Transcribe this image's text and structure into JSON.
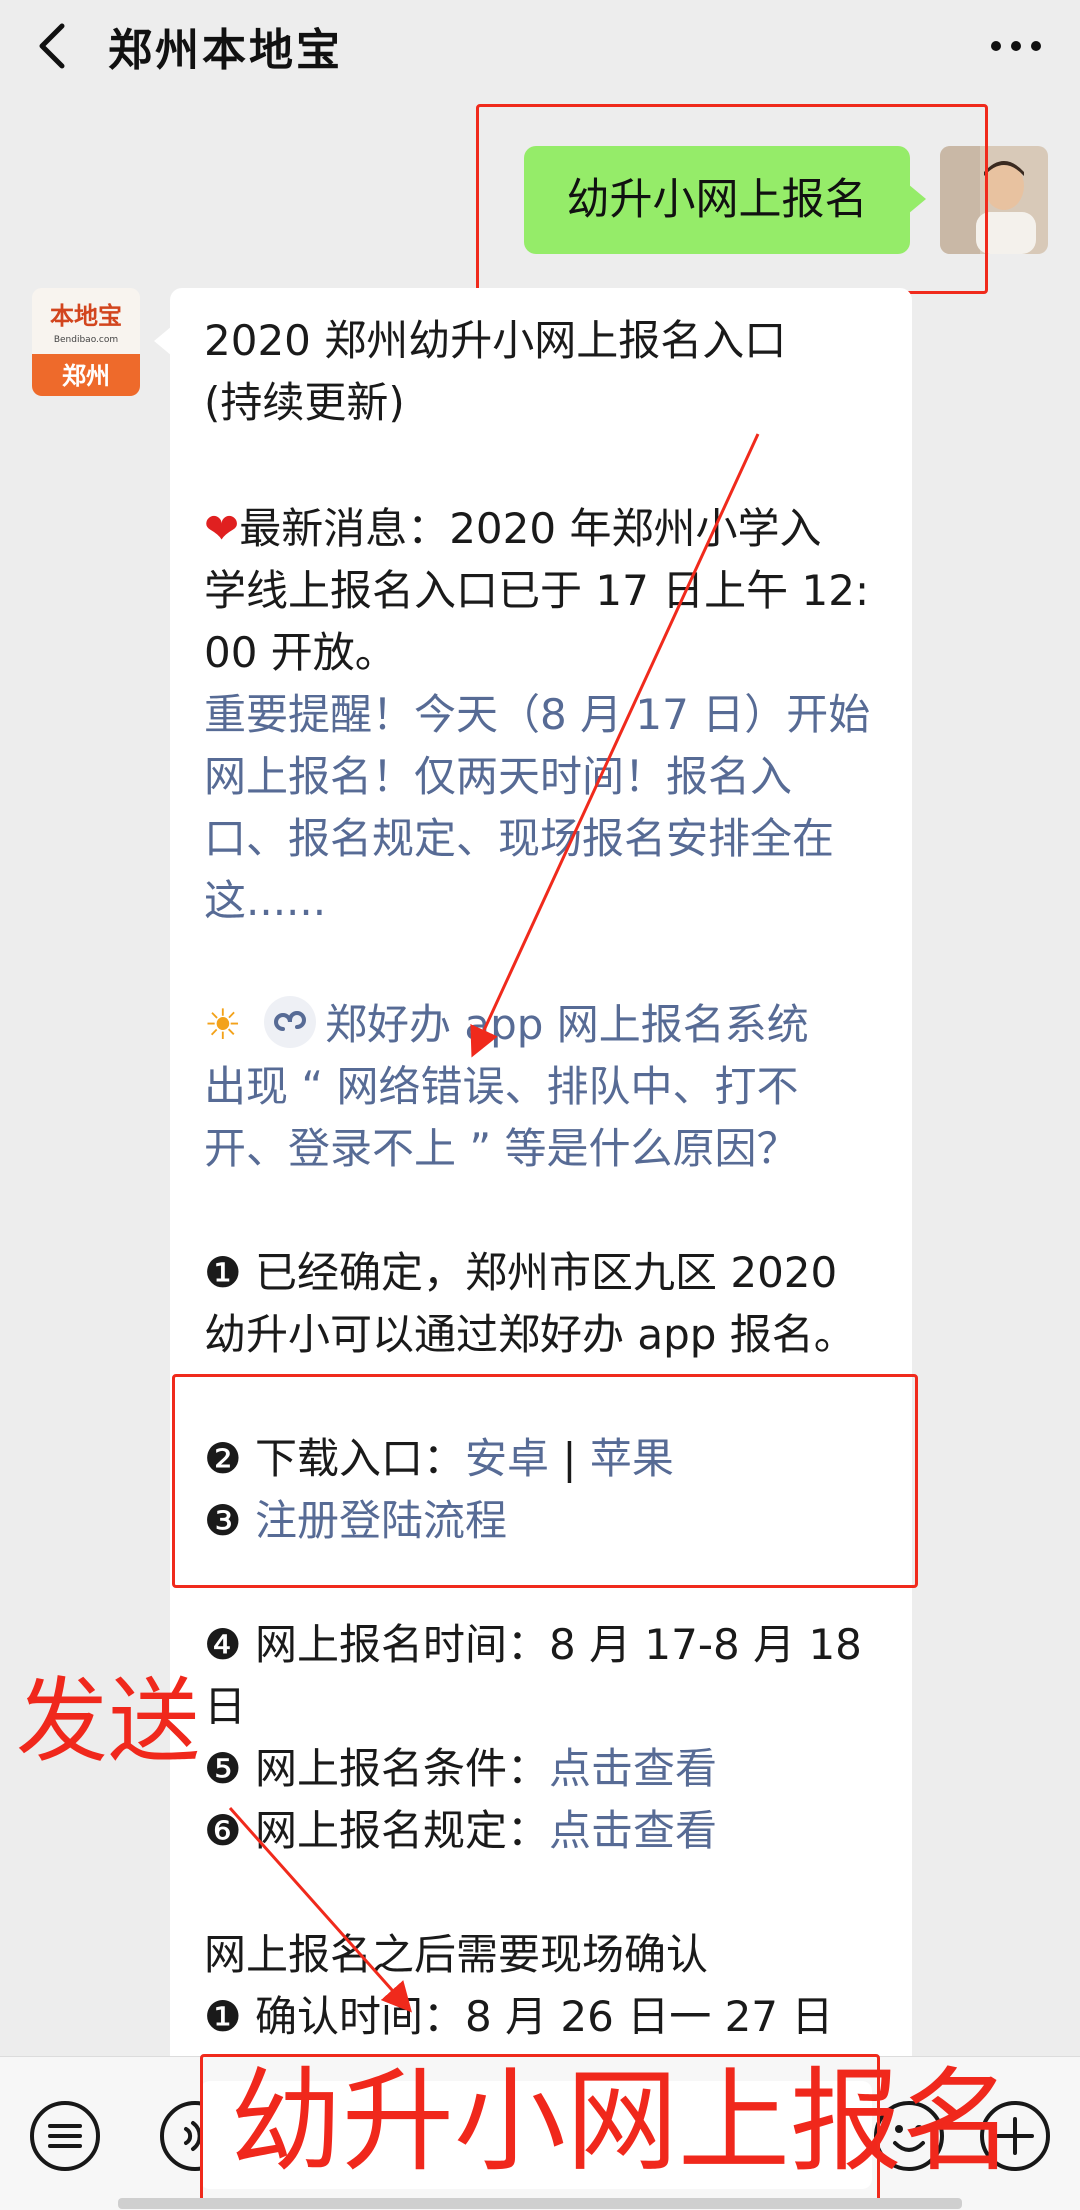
{
  "header": {
    "title": "郑州本地宝"
  },
  "sent_message": "幼升小网上报名",
  "bot_avatar": {
    "line1": "本地宝",
    "line2": "Bendibao.com",
    "line3": "郑州"
  },
  "message": {
    "title1": "2020 郑州幼升小网上报名入口",
    "title2": "(持续更新)",
    "news_prefix": "最新消息：2020 年郑州小学入",
    "news2": "学线上报名入口已于 17 日上午 12:",
    "news3": "00 开放。",
    "reminder1": "重要提醒！今天（8 月 17 日）开始",
    "reminder2": "网上报名！仅两天时间！报名入",
    "reminder3": "口、报名规定、现场报名安排全在",
    "reminder4": "这......",
    "faq1": "郑好办 app 网上报名系统",
    "faq2": "出现 “ 网络错误、排队中、打不",
    "faq3": "开、登录不上 ” 等是什么原因？",
    "p1a": "❶ 已经确定，郑州市区九区 2020",
    "p1b": "幼升小可以通过郑好办 app 报名。",
    "p2_label": "❷ 下载入口：",
    "p2_android": "安卓",
    "p2_sep": " | ",
    "p2_apple": "苹果",
    "p3_num": "❸ ",
    "p3_link": "注册登陆流程",
    "p4a": "❹ 网上报名时间：8 月 17-8 月 18",
    "p4b": "日",
    "p5_label": "❺ 网上报名条件：",
    "p5_link": "点击查看",
    "p6_label": "❻ 网上报名规定：",
    "p6_link": "点击查看",
    "confirm_title": "网上报名之后需要现场确认",
    "confirm1": "❶ 确认时间：8 月 26 日一 27 日"
  },
  "annotation": {
    "send_label": "发送"
  },
  "input": {
    "value": "幼升小网上报名"
  },
  "icons": [
    "list-icon",
    "voice-icon",
    "emoji-icon",
    "plus-icon"
  ],
  "colors": {
    "link": "#576b95",
    "sent_bubble": "#95ec69",
    "annotation": "#f0281c"
  }
}
